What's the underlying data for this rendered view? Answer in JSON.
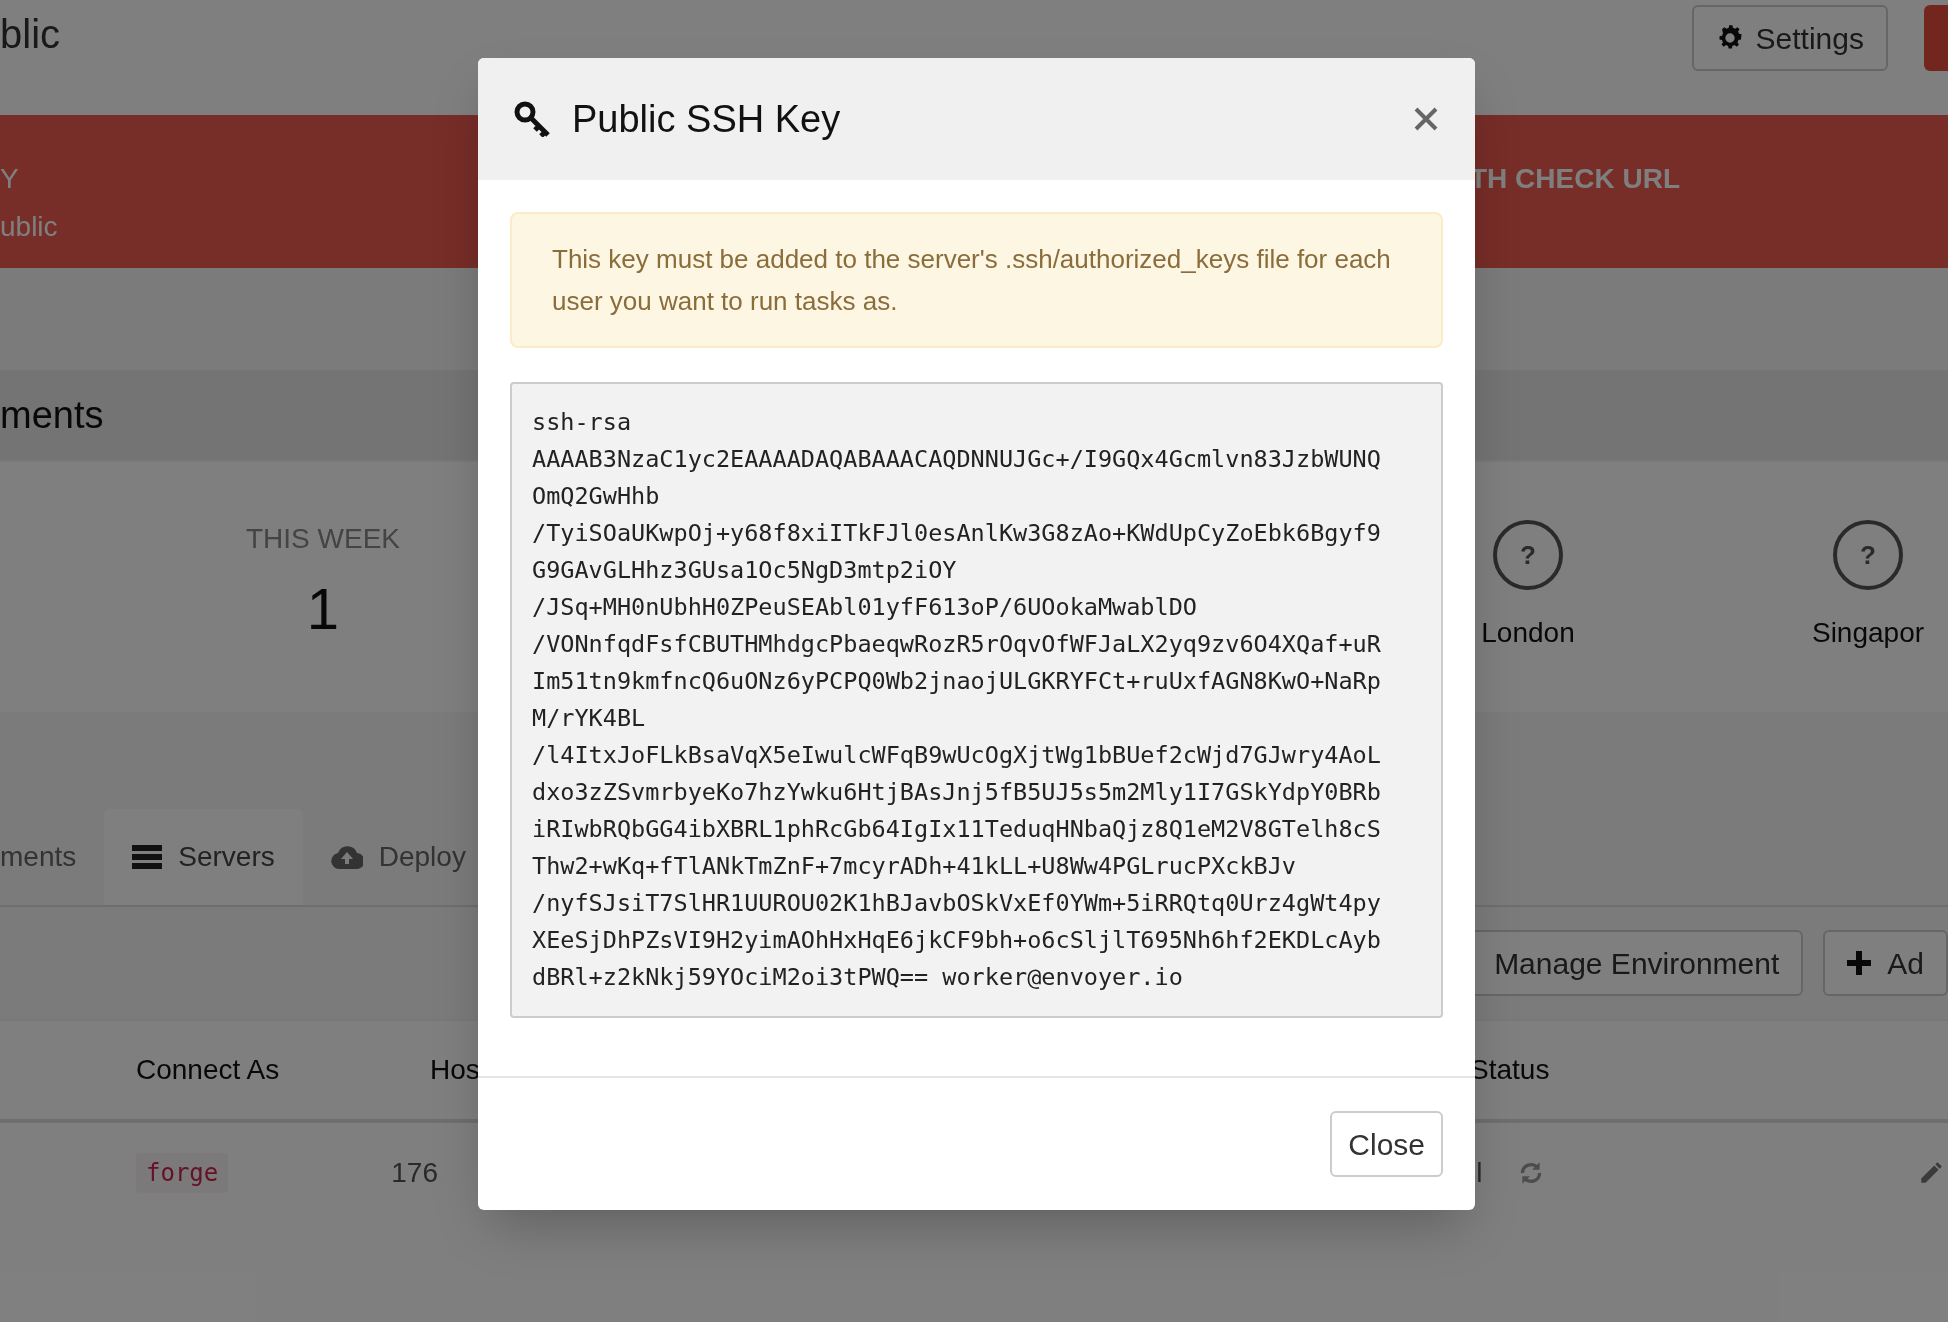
{
  "page": {
    "title": "blic",
    "settings_button": "Settings",
    "banner": {
      "left_lines": [
        "Y",
        "ublic"
      ],
      "right_text": "TH CHECK URL"
    },
    "section_heading": "ments",
    "stats": {
      "label": "THIS WEEK",
      "value": "1"
    },
    "locations": [
      {
        "name": "London",
        "status_glyph": "?"
      },
      {
        "name": "Singapor",
        "status_glyph": "?"
      }
    ],
    "tabs": [
      {
        "label": "ments",
        "selected": false
      },
      {
        "label": "Servers",
        "selected": true
      },
      {
        "label": "Deploy",
        "selected": false
      }
    ],
    "actions": [
      "Manage Environment",
      "Ad"
    ],
    "table": {
      "columns": [
        "Connect As",
        "Hos",
        "Status"
      ],
      "rows": [
        {
          "connect_as": "forge",
          "host": "176",
          "status": "l"
        }
      ]
    }
  },
  "modal": {
    "title": "Public SSH Key",
    "alert": "This key must be added to the server's .ssh/authorized_keys file for each user you want to run tasks as.",
    "key_lines": [
      "ssh-rsa",
      "AAAAB3NzaC1yc2EAAAADAQABAAACAQDNNUJGc+/I9GQx4Gcmlvn83JzbWUNQ",
      "OmQ2GwHhb",
      "/TyiSOaUKwpOj+y68f8xiITkFJl0esAnlKw3G8zAo+KWdUpCyZoEbk6Bgyf9",
      "G9GAvGLHhz3GUsa1Oc5NgD3mtp2iOY",
      "/JSq+MH0nUbhH0ZPeuSEAbl01yfF613oP/6UOokaMwablDO",
      "/VONnfqdFsfCBUTHMhdgcPbaeqwRozR5rOqvOfWFJaLX2yq9zv6O4XQaf+uR",
      "Im51tn9kmfncQ6uONz6yPCPQ0Wb2jnaojULGKRYFCt+ruUxfAGN8KwO+NaRp",
      "M/rYK4BL",
      "/l4ItxJoFLkBsaVqX5eIwulcWFqB9wUcOgXjtWg1bBUef2cWjd7GJwry4AoL",
      "dxo3zZSvmrbyeKo7hzYwku6HtjBAsJnj5fB5UJ5s5m2Mly1I7GSkYdpY0BRb",
      "iRIwbRQbGG4ibXBRL1phRcGb64IgIx11TeduqHNbaQjz8Q1eM2V8GTelh8cS",
      "Thw2+wKq+fTlANkTmZnF+7mcyrADh+41kLL+U8Ww4PGLrucPXckBJv",
      "/nyfSJsiT7SlHR1UUROU02K1hBJavbOSkVxEf0YWm+5iRRQtq0Urz4gWt4py",
      "XEeSjDhPZsVI9H2yimAOhHxHqE6jkCF9bh+o6cSljlT695Nh6hf2EKDLcAyb",
      "dBRl+z2kNkj59YOciM2oi3tPWQ== worker@envoyer.io"
    ],
    "close_button": "Close"
  }
}
